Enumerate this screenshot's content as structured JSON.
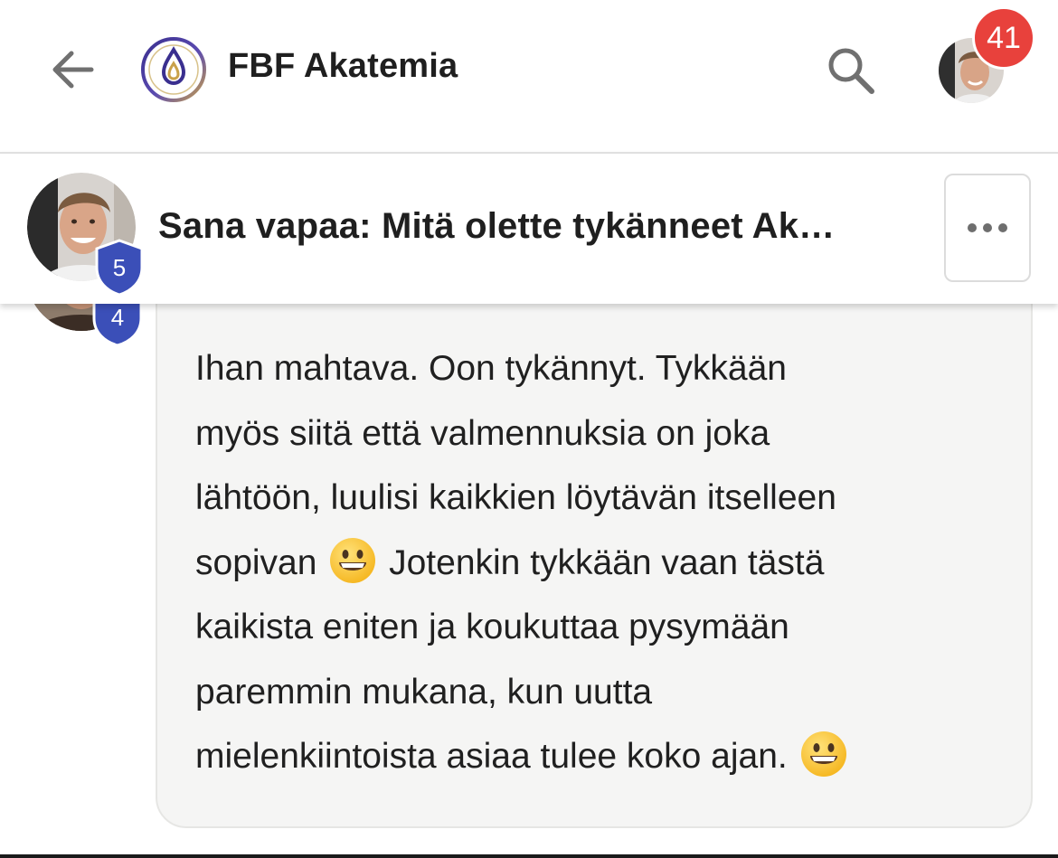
{
  "header": {
    "app_title": "FBF Akatemia",
    "notification_count": "41",
    "icons": {
      "back": "arrow-left-icon",
      "logo": "fbf-droplet-logo",
      "search": "search-icon"
    }
  },
  "topic": {
    "title": "Sana vapaa: Mitä olette tykänneet Ak…",
    "author_trust_level": "5",
    "more_icon": "ellipsis-icon"
  },
  "post": {
    "author_trust_level": "4",
    "lines": [
      "Ihan mahtava. Oon tykännyt. Tykkään",
      "myös siitä että valmennuksia on joka",
      "lähtöön, luulisi kaikkien löytävän itselleen"
    ],
    "line4_before_emoji": "sopivan ",
    "line4_after_emoji": " Jotenkin tykkään vaan tästä",
    "line5": "kaikista eniten ja koukuttaa pysymään",
    "line6": "paremmin mukana, kun uutta",
    "line7_before_emoji": "mielenkiintoista asiaa tulee koko ajan. ",
    "emoji": "grinning-face-emoji"
  },
  "colors": {
    "badge_red": "#e8413c",
    "trust_shield_blue": "#3b4fb8",
    "bubble_bg": "#f5f5f4",
    "logo_purple": "#3a2f8f",
    "logo_gold": "#c9a14a"
  }
}
